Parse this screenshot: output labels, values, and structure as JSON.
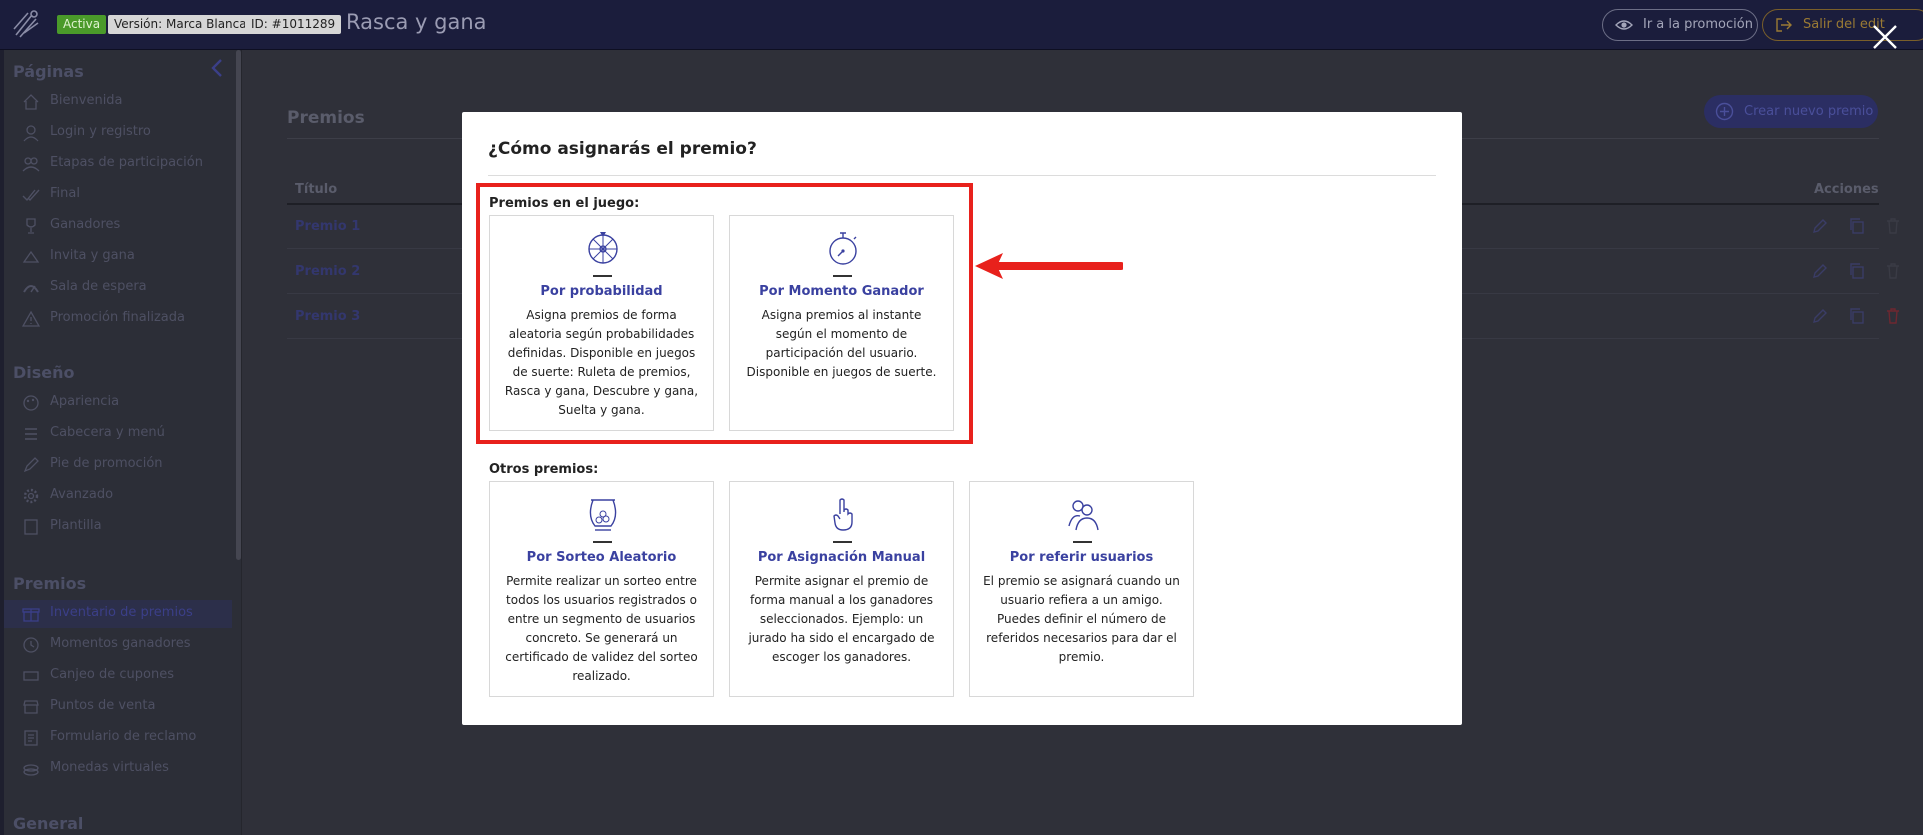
{
  "topbar": {
    "status_badge": "Activa",
    "version_badge": "Versión: Marca Blanca",
    "id_badge": "ID: #1011289",
    "app_title": "Rasca y gana",
    "goto_promo_label": "Ir a la promoción",
    "exit_editor_label": "Salir del edit"
  },
  "sidebar": {
    "sections": {
      "pages": "Páginas",
      "design": "Diseño",
      "prizes": "Premios",
      "general": "General"
    },
    "pages_items": [
      {
        "label": "Bienvenida",
        "icon": "home-icon"
      },
      {
        "label": "Login y registro",
        "icon": "user-icon"
      },
      {
        "label": "Etapas de participación",
        "icon": "users-icon"
      },
      {
        "label": "Final",
        "icon": "double-check-icon"
      },
      {
        "label": "Ganadores",
        "icon": "trophy-icon"
      },
      {
        "label": "Invita y gana",
        "icon": "invite-icon"
      },
      {
        "label": "Sala de espera",
        "icon": "gauge-icon"
      },
      {
        "label": "Promoción finalizada",
        "icon": "warning-icon"
      }
    ],
    "design_items": [
      {
        "label": "Apariencia",
        "icon": "palette-icon"
      },
      {
        "label": "Cabecera y menú",
        "icon": "menu-icon"
      },
      {
        "label": "Pie de promoción",
        "icon": "pen-icon"
      },
      {
        "label": "Avanzado",
        "icon": "gear-icon"
      },
      {
        "label": "Plantilla",
        "icon": "template-icon"
      }
    ],
    "prizes_items": [
      {
        "label": "Inventario de premios",
        "icon": "gift-icon"
      },
      {
        "label": "Momentos ganadores",
        "icon": "clock-icon"
      },
      {
        "label": "Canjeo de cupones",
        "icon": "coupon-icon"
      },
      {
        "label": "Puntos de venta",
        "icon": "store-icon"
      },
      {
        "label": "Formulario de reclamo",
        "icon": "form-icon"
      },
      {
        "label": "Monedas virtuales",
        "icon": "coins-icon"
      }
    ]
  },
  "main": {
    "title": "Premios",
    "new_prize_label": "Crear nuevo premio",
    "table": {
      "col_title": "Título",
      "col_actions": "Acciones",
      "rows": [
        "Premio 1",
        "Premio 2",
        "Premio 3"
      ]
    }
  },
  "modal": {
    "title": "¿Cómo asignarás el premio?",
    "section_game": "Premios en el juego:",
    "section_other": "Otros premios:",
    "game_cards": [
      {
        "title": "Por probabilidad",
        "description": "Asigna premios de forma aleatoria según probabilidades definidas. Disponible en juegos de suerte: Ruleta de premios, Rasca y gana, Descubre y gana, Suelta y gana.",
        "icon": "wheel-icon"
      },
      {
        "title": "Por Momento Ganador",
        "description": "Asigna premios al instante según el momento de participación del usuario. Disponible en juegos de suerte.",
        "icon": "stopwatch-icon"
      }
    ],
    "other_cards": [
      {
        "title": "Por Sorteo Aleatorio",
        "description": "Permite realizar un sorteo entre todos los usuarios registrados o entre un segmento de usuarios concreto. Se generará un certificado de validez del sorteo realizado.",
        "icon": "lottery-drum-icon"
      },
      {
        "title": "Por Asignación Manual",
        "description": "Permite asignar el premio de forma manual a los ganadores seleccionados. Ejemplo: un jurado ha sido el encargado de escoger los ganadores.",
        "icon": "hand-icon"
      },
      {
        "title": "Por referir usuarios",
        "description": "El premio se asignará cuando un usuario refiera a un amigo. Puedes definir el número de referidos necesarios para dar el premio.",
        "icon": "people-icon"
      }
    ]
  },
  "colors": {
    "topbar_bg": "#1b1d3c",
    "accent": "#3a41a0",
    "highlight": "#e8211c"
  }
}
